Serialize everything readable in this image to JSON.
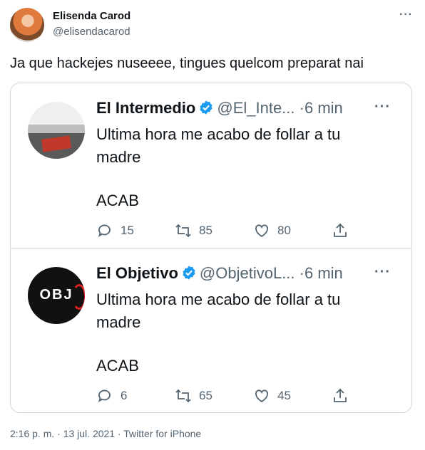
{
  "tweet": {
    "author_name": "Elisenda Carod",
    "author_handle": "@elisendacarod",
    "text": "Ja que hackejes nuseeee, tingues quelcom preparat nai",
    "more_icon": "more-horizontal-icon",
    "footer": "2:16 p. m. · 13 jul. 2021 · Twitter for iPhone"
  },
  "quoted_tweets": [
    {
      "name": "El Intermedio",
      "handle": "@El_Inte...",
      "time": "·6 min",
      "text_line1": "Ultima hora me acabo de follar a tu",
      "text_line2": "madre",
      "text_line3": "ACAB",
      "replies": "15",
      "retweets": "85",
      "likes": "80"
    },
    {
      "name": "El Objetivo",
      "handle": "@ObjetivoL...",
      "time": "·6 min",
      "avatar_text": "OBJ",
      "text_line1": "Ultima hora me acabo de follar a tu",
      "text_line2": "madre",
      "text_line3": "ACAB",
      "replies": "6",
      "retweets": "65",
      "likes": "45"
    }
  ],
  "colors": {
    "verified": "#1d9bf0",
    "secondary_text": "#536471",
    "border": "#cfd9de"
  }
}
